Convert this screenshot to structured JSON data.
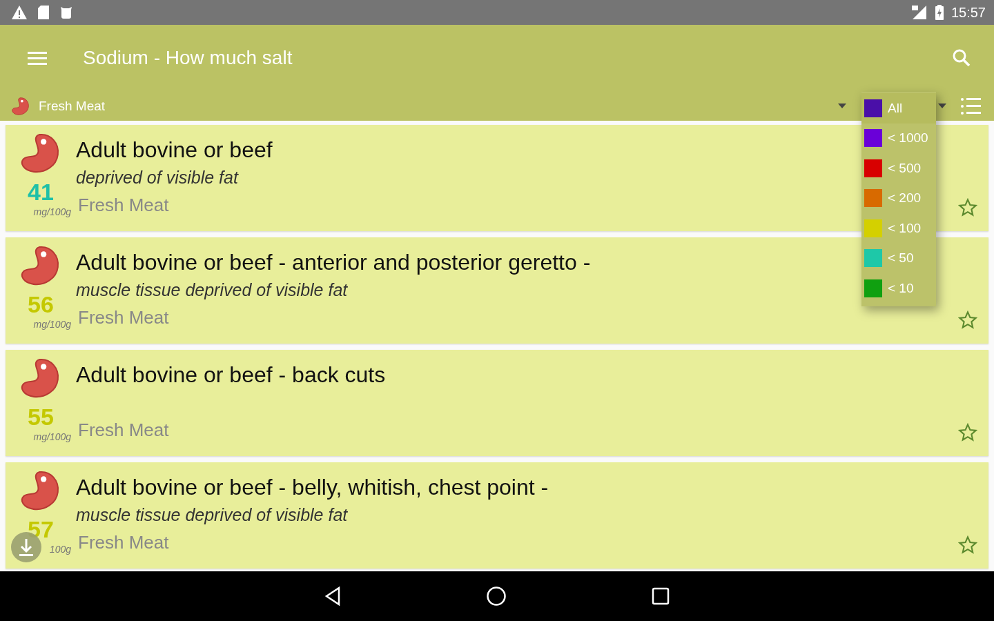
{
  "status_bar": {
    "time": "15:57"
  },
  "app_bar": {
    "title": "Sodium - How much salt"
  },
  "category_filter": {
    "label": "Fresh Meat"
  },
  "level_filter": {
    "expanded": true,
    "options": [
      {
        "label": "All",
        "color": "#4a0fa8",
        "selected": true
      },
      {
        "label": "< 1000",
        "color": "#6a00d8",
        "selected": false
      },
      {
        "label": "< 500",
        "color": "#d80000",
        "selected": false
      },
      {
        "label": "< 200",
        "color": "#d86a00",
        "selected": false
      },
      {
        "label": "< 100",
        "color": "#d4d000",
        "selected": false
      },
      {
        "label": "< 50",
        "color": "#1ec8a8",
        "selected": false
      },
      {
        "label": "< 10",
        "color": "#10a010",
        "selected": false
      }
    ]
  },
  "foods": [
    {
      "name": "Adult bovine or beef",
      "description": "deprived of visible fat",
      "category": "Fresh Meat",
      "sodium": "41",
      "unit": "mg/100g",
      "color": "#1ec0a8",
      "favorite": false
    },
    {
      "name": "Adult bovine or beef - anterior and posterior geretto -",
      "description": "muscle tissue deprived of visible fat",
      "category": "Fresh Meat",
      "sodium": "56",
      "unit": "mg/100g",
      "color": "#c4c800",
      "favorite": false
    },
    {
      "name": "Adult bovine or beef - back cuts",
      "category": "Fresh Meat",
      "sodium": "55",
      "unit": "mg/100g",
      "color": "#c4c800",
      "favorite": false
    },
    {
      "name": "Adult bovine or beef - belly, whitish, chest point -",
      "description": "muscle tissue deprived of visible fat",
      "category": "Fresh Meat",
      "sodium": "57",
      "unit": "100g",
      "color": "#c4c800",
      "favorite": false
    }
  ]
}
